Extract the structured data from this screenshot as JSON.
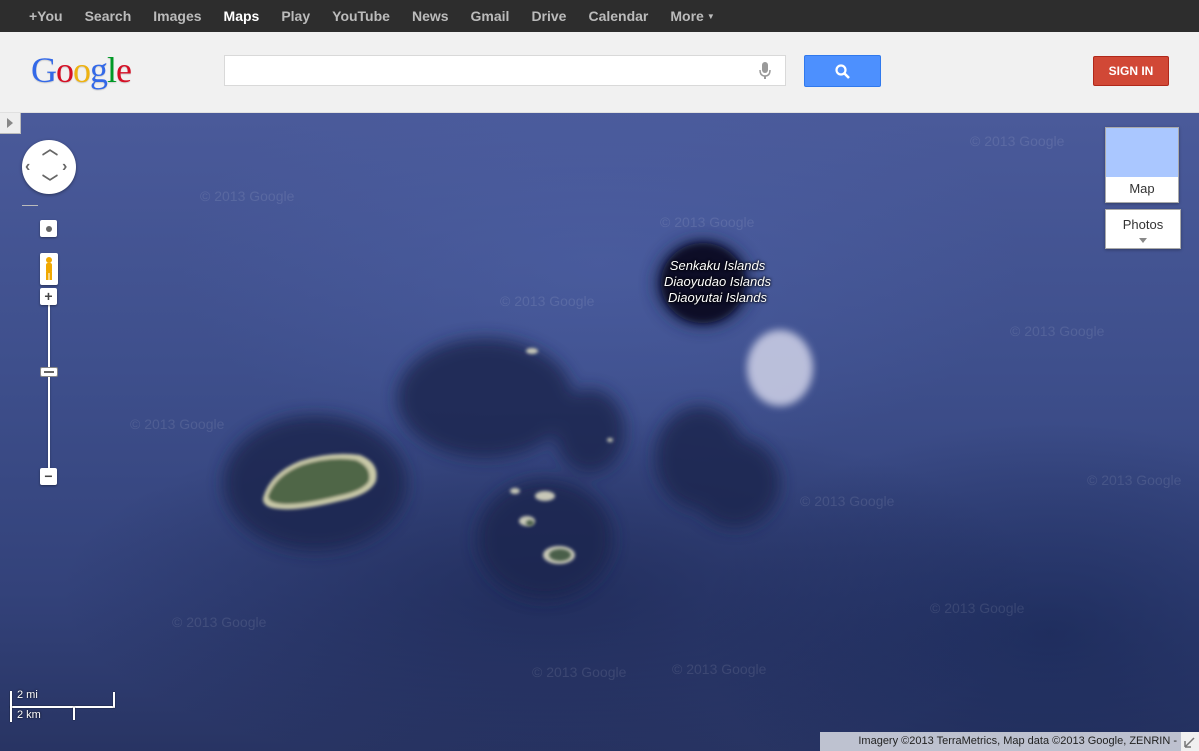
{
  "topbar": {
    "items": [
      {
        "label": "+You"
      },
      {
        "label": "Search"
      },
      {
        "label": "Images"
      },
      {
        "label": "Maps"
      },
      {
        "label": "Play"
      },
      {
        "label": "YouTube"
      },
      {
        "label": "News"
      },
      {
        "label": "Gmail"
      },
      {
        "label": "Drive"
      },
      {
        "label": "Calendar"
      },
      {
        "label": "More"
      }
    ],
    "active": "Maps"
  },
  "header": {
    "logo_text": "Google",
    "search_value": "",
    "signin_label": "SIGN IN",
    "icons": [
      "microphone-icon",
      "search-icon"
    ]
  },
  "map": {
    "place_label": [
      "Senkaku Islands",
      "Diaoyudao Islands",
      "Diaoyutai Islands"
    ],
    "watermark": "© 2013 Google",
    "map_type_label": "Map",
    "photos_label": "Photos",
    "scale_miles": "2 mi",
    "scale_km": "2 km",
    "attribution": "Imagery ©2013 TerraMetrics, Map data ©2013 Google, ZENRIN -",
    "colors": {
      "water": "#3e4f8c",
      "signin": "#d14836",
      "search_button": "#4d90fe"
    }
  }
}
